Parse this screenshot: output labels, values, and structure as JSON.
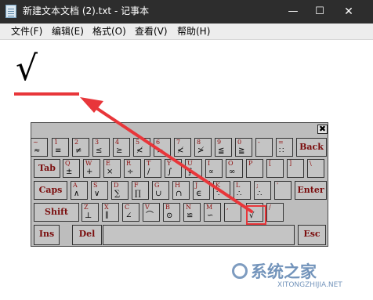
{
  "window": {
    "title": "新建文本文档 (2).txt - 记事本",
    "buttons": {
      "minimize": "—",
      "maximize": "☐",
      "close": "✕"
    }
  },
  "menu": [
    "文件(F)",
    "编辑(E)",
    "格式(O)",
    "查看(V)",
    "帮助(H)"
  ],
  "document": {
    "content": "√"
  },
  "keyboard": {
    "close_glyph": "✖",
    "row1": [
      {
        "top": "~",
        "bottom": "≈"
      },
      {
        "top": "1",
        "bottom": "≡"
      },
      {
        "top": "2",
        "bottom": "≠"
      },
      {
        "top": "3",
        "bottom": "≤"
      },
      {
        "top": "4",
        "bottom": "≥"
      },
      {
        "top": "5",
        "bottom": "≮"
      },
      {
        "top": "6",
        "bottom": ">"
      },
      {
        "top": "7",
        "bottom": "≮"
      },
      {
        "top": "8",
        "bottom": "≯"
      },
      {
        "top": "9",
        "bottom": "≦"
      },
      {
        "top": "0",
        "bottom": "≧"
      },
      {
        "top": "-",
        "bottom": ""
      },
      {
        "top": "=",
        "bottom": "∷"
      }
    ],
    "backspace": "Back",
    "tab": "Tab",
    "row2": [
      {
        "top": "Q",
        "bottom": "±"
      },
      {
        "top": "W",
        "bottom": "+"
      },
      {
        "top": "E",
        "bottom": "×"
      },
      {
        "top": "R",
        "bottom": "÷"
      },
      {
        "top": "T",
        "bottom": "∕"
      },
      {
        "top": "Y",
        "bottom": "∫"
      },
      {
        "top": "U",
        "bottom": "∮"
      },
      {
        "top": "I",
        "bottom": "∝"
      },
      {
        "top": "O",
        "bottom": "∞"
      },
      {
        "top": "P",
        "bottom": ""
      },
      {
        "top": "[",
        "bottom": ""
      },
      {
        "top": "]",
        "bottom": ""
      },
      {
        "top": "\\",
        "bottom": ""
      }
    ],
    "caps": "Caps",
    "row3": [
      {
        "top": "A",
        "bottom": "∧"
      },
      {
        "top": "S",
        "bottom": "∨"
      },
      {
        "top": "D",
        "bottom": "∑"
      },
      {
        "top": "F",
        "bottom": "∏"
      },
      {
        "top": "G",
        "bottom": "∪"
      },
      {
        "top": "H",
        "bottom": "∩"
      },
      {
        "top": "J",
        "bottom": "∈"
      },
      {
        "top": "K",
        "bottom": "∵"
      },
      {
        "top": "L",
        "bottom": "∴"
      },
      {
        "top": ";",
        "bottom": "∴"
      },
      {
        "top": "'",
        "bottom": ""
      }
    ],
    "enter": "Enter",
    "shift": "Shift",
    "row4": [
      {
        "top": "Z",
        "bottom": "⊥"
      },
      {
        "top": "X",
        "bottom": "∥"
      },
      {
        "top": "C",
        "bottom": "∠"
      },
      {
        "top": "V",
        "bottom": "⌒"
      },
      {
        "top": "B",
        "bottom": "⊙"
      },
      {
        "top": "N",
        "bottom": "≌"
      },
      {
        "top": "M",
        "bottom": "∽"
      },
      {
        "top": ",",
        "bottom": ""
      },
      {
        "top": ".",
        "bottom": "√"
      },
      {
        "top": "/",
        "bottom": ""
      }
    ],
    "ins": "Ins",
    "del": "Del",
    "esc": "Esc"
  },
  "watermark": {
    "text": "系统之家",
    "url": "XITONGZHIJIA.NET"
  },
  "colors": {
    "titlebar": "#2d2d2d",
    "highlight": "#e8363a",
    "key_text": "#8f0d0d"
  }
}
